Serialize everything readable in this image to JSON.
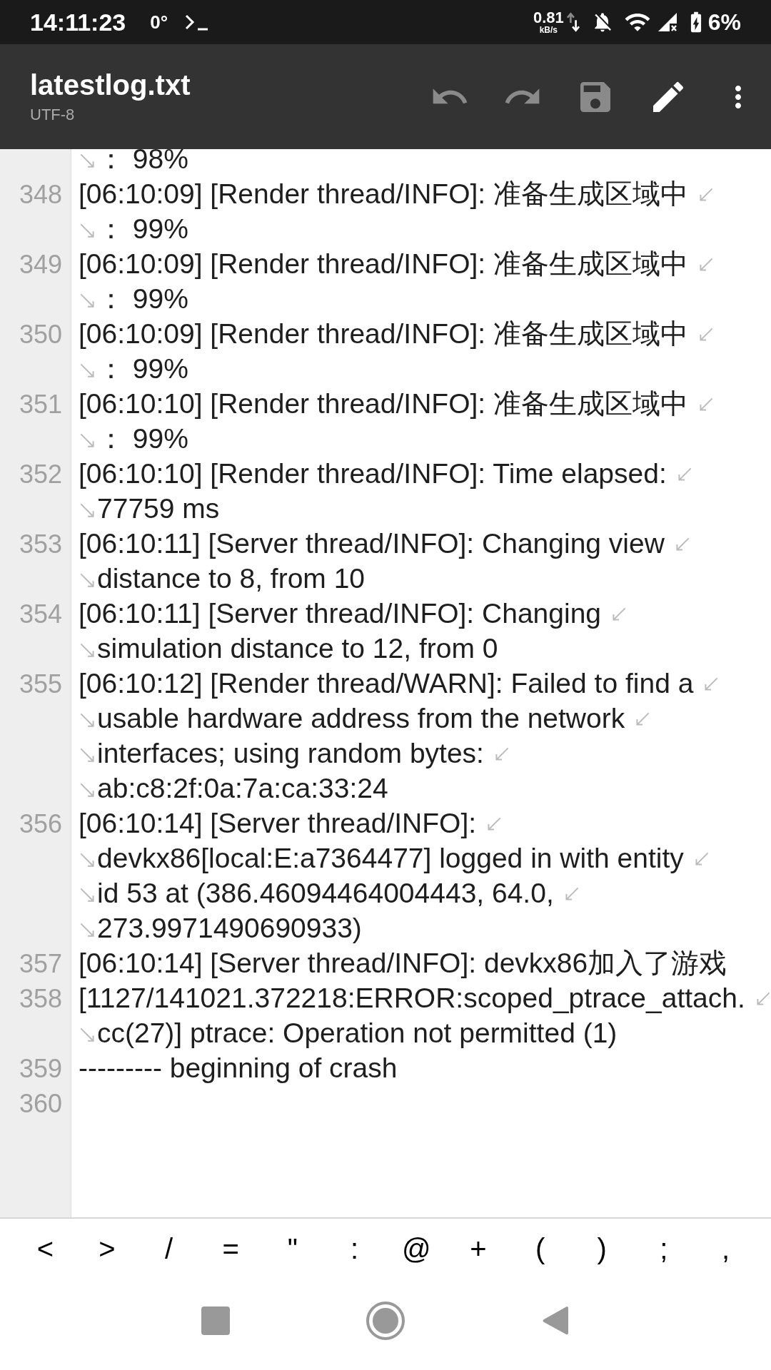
{
  "status_bar": {
    "time": "14:11:23",
    "temperature": "0°",
    "net_speed": "0.81",
    "net_unit": "kB/s",
    "battery": "6%"
  },
  "toolbar": {
    "title": "latestlog.txt",
    "encoding": "UTF-8",
    "actions": [
      {
        "kind": "undo",
        "disabled": true
      },
      {
        "kind": "redo",
        "disabled": true
      },
      {
        "kind": "save",
        "disabled": true
      },
      {
        "kind": "edit",
        "disabled": false
      },
      {
        "kind": "more",
        "disabled": false
      }
    ]
  },
  "editor": {
    "lines": [
      {
        "continued": true,
        "segments": [
          "： 98%"
        ]
      },
      {
        "number": "348",
        "segments": [
          "[06:10:09] [Render thread/INFO]: 准备生成区域中",
          "： 99%"
        ]
      },
      {
        "number": "349",
        "segments": [
          "[06:10:09] [Render thread/INFO]: 准备生成区域中",
          "： 99%"
        ]
      },
      {
        "number": "350",
        "segments": [
          "[06:10:09] [Render thread/INFO]: 准备生成区域中",
          "： 99%"
        ]
      },
      {
        "number": "351",
        "segments": [
          "[06:10:10] [Render thread/INFO]: 准备生成区域中",
          "： 99%"
        ]
      },
      {
        "number": "352",
        "segments": [
          "[06:10:10] [Render thread/INFO]: Time elapsed:",
          "77759 ms"
        ]
      },
      {
        "number": "353",
        "segments": [
          "[06:10:11] [Server thread/INFO]: Changing view",
          "distance to 8, from 10"
        ]
      },
      {
        "number": "354",
        "segments": [
          "[06:10:11] [Server thread/INFO]: Changing",
          "simulation distance to 12, from 0"
        ]
      },
      {
        "number": "355",
        "segments": [
          "[06:10:12] [Render thread/WARN]: Failed to find a",
          "usable hardware address from the network",
          "interfaces; using random bytes:",
          "ab:c8:2f:0a:7a:ca:33:24"
        ]
      },
      {
        "number": "356",
        "segments": [
          "[06:10:14] [Server thread/INFO]:",
          "devkx86[local:E:a7364477] logged in with entity",
          "id 53 at (386.46094464004443, 64.0,",
          "273.9971490690933)"
        ]
      },
      {
        "number": "357",
        "segments": [
          "[06:10:14] [Server thread/INFO]: devkx86加入了游戏"
        ]
      },
      {
        "number": "358",
        "segments": [
          "[1127/141021.372218:ERROR:scoped_ptrace_attach.",
          "cc(27)] ptrace: Operation not permitted (1)"
        ]
      },
      {
        "number": "359",
        "segments": [
          "--------- beginning of crash"
        ]
      },
      {
        "number": "360"
      }
    ]
  },
  "symbol_keys": [
    "<",
    ">",
    "/",
    "=",
    "\"",
    ":",
    "@",
    "+",
    "(",
    ")",
    ";",
    ","
  ],
  "nav_bar": [
    {
      "kind": "recents"
    },
    {
      "kind": "home"
    },
    {
      "kind": "back"
    }
  ]
}
